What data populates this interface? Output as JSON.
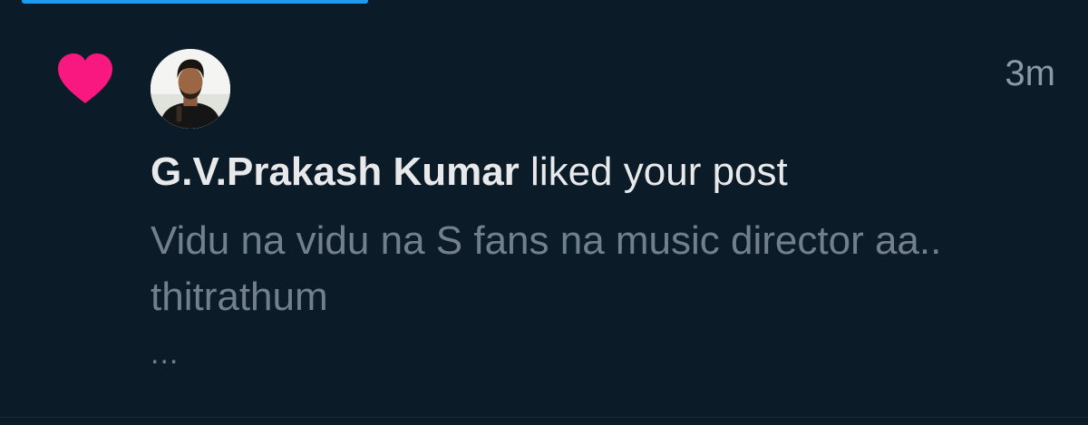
{
  "notification": {
    "icon": "heart-icon",
    "icon_color": "#f91880",
    "avatar_icon": "user-avatar",
    "timestamp": "3m",
    "author_name": "G.V.Prakash Kumar",
    "action_text": " liked your post",
    "post_preview": "Vidu na vidu na S fans na music director aa.. thitrathum",
    "truncation": "..."
  },
  "colors": {
    "background": "#0c1b28",
    "primary_text": "#e7e9ea",
    "secondary_text": "#8b98a5",
    "accent": "#1d9bf0"
  }
}
